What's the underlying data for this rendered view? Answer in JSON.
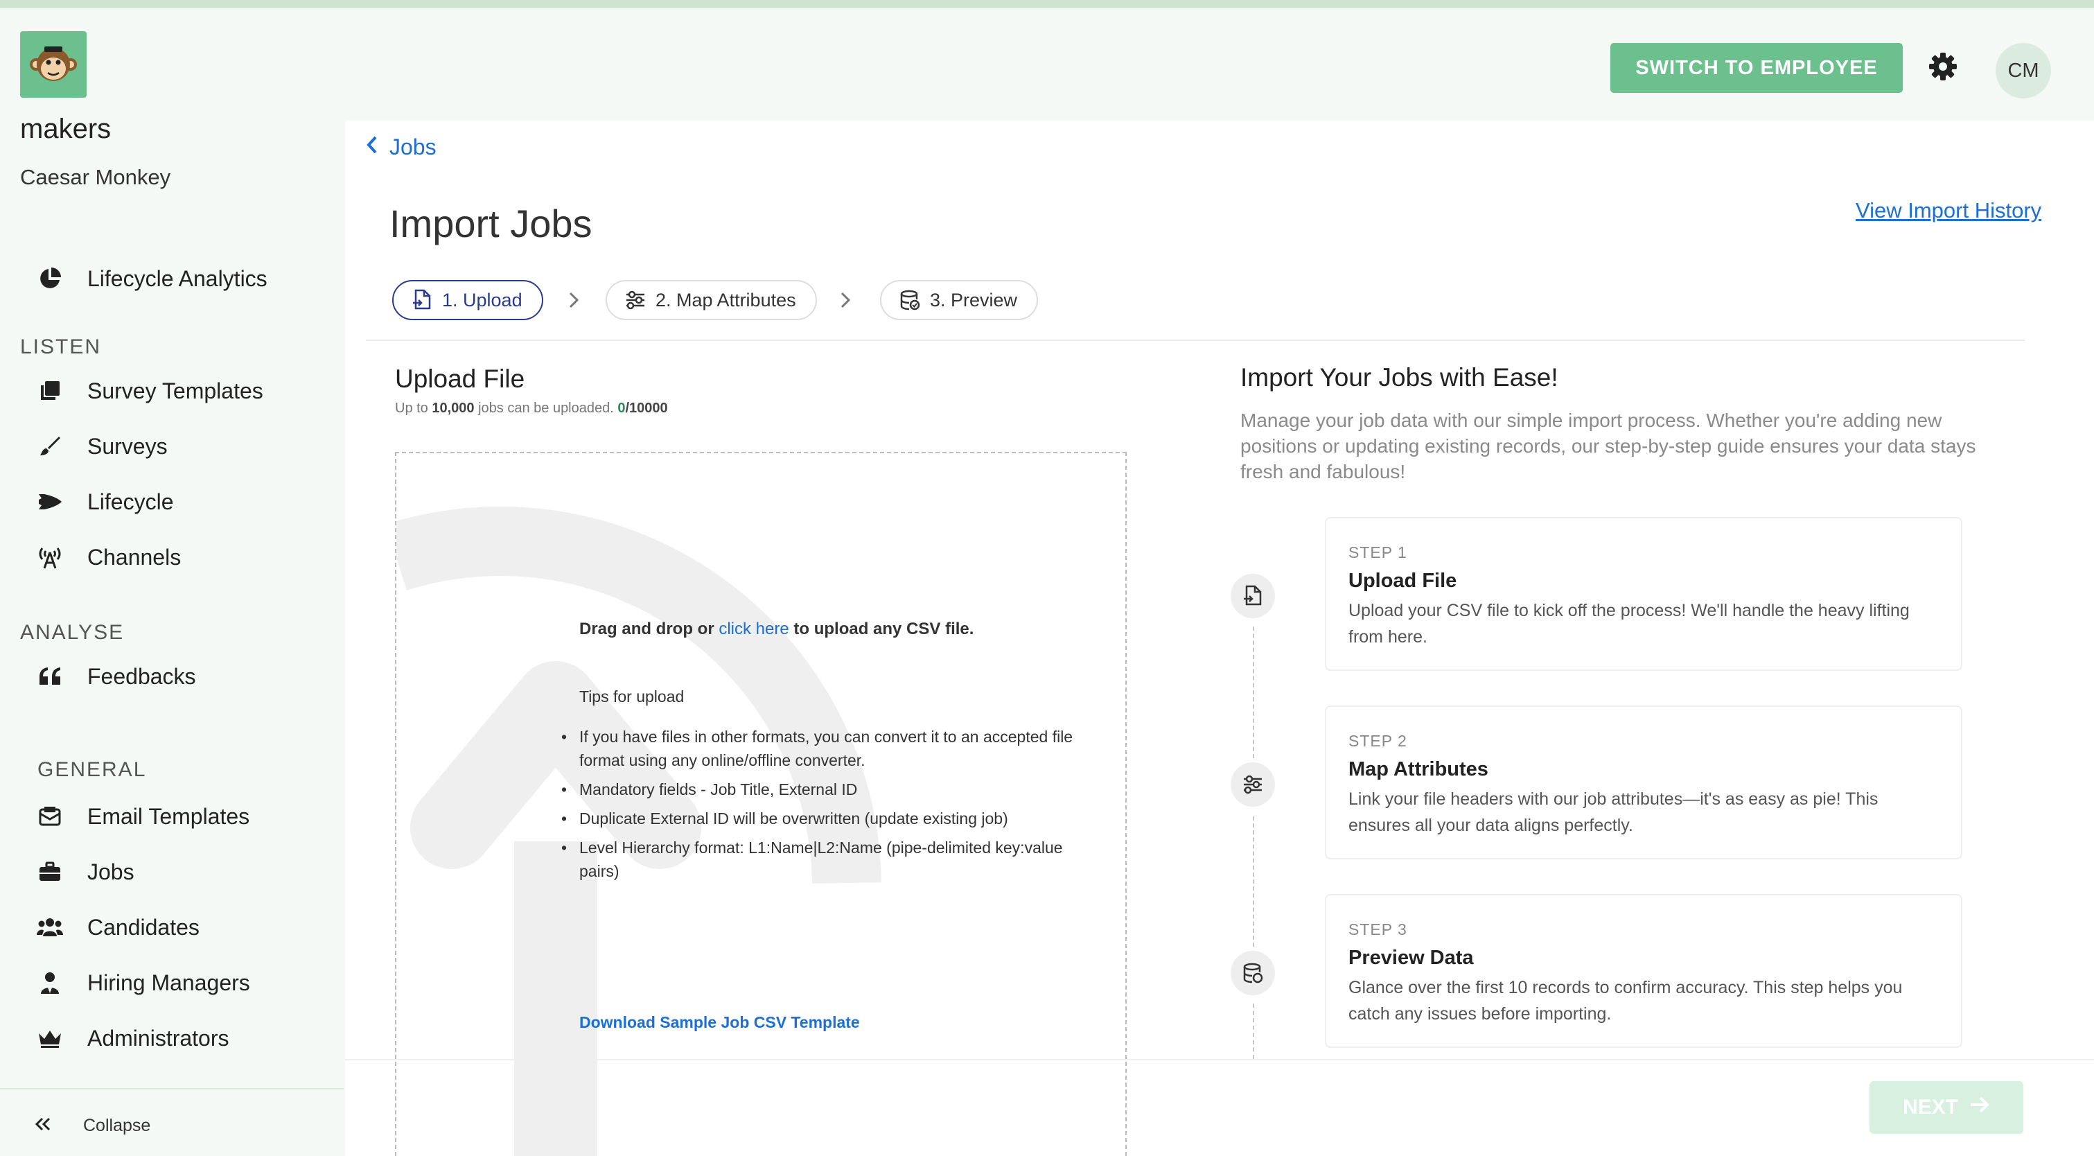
{
  "sidebar": {
    "org_name": "makers",
    "user_name": "Caesar Monkey",
    "items_top": [
      {
        "label": "Lifecycle Analytics",
        "icon": "pie-chart-icon"
      }
    ],
    "sections": [
      {
        "title": "LISTEN",
        "items": [
          {
            "label": "Survey Templates",
            "icon": "copy-icon"
          },
          {
            "label": "Surveys",
            "icon": "paint-brush-icon"
          },
          {
            "label": "Lifecycle",
            "icon": "space-shuttle-icon"
          },
          {
            "label": "Channels",
            "icon": "broadcast-tower-icon"
          }
        ]
      },
      {
        "title": "ANALYSE",
        "items": [
          {
            "label": "Feedbacks",
            "icon": "quote-icon"
          }
        ]
      },
      {
        "title": "GENERAL",
        "items": [
          {
            "label": "Email Templates",
            "icon": "envelope-icon"
          },
          {
            "label": "Jobs",
            "icon": "briefcase-icon"
          },
          {
            "label": "Candidates",
            "icon": "users-icon"
          },
          {
            "label": "Hiring Managers",
            "icon": "user-tie-icon"
          },
          {
            "label": "Administrators",
            "icon": "crown-icon"
          }
        ]
      }
    ],
    "collapse_label": "Collapse"
  },
  "header": {
    "switch_label": "SWITCH TO EMPLOYEE",
    "avatar_initials": "CM"
  },
  "main": {
    "back_label": "Jobs",
    "title": "Import Jobs",
    "history_link": "View Import History",
    "steps": [
      {
        "label": "1. Upload",
        "icon": "file-import-icon",
        "active": true
      },
      {
        "label": "2. Map Attributes",
        "icon": "sliders-icon",
        "active": false
      },
      {
        "label": "3. Preview",
        "icon": "database-icon",
        "active": false
      }
    ],
    "upload": {
      "title": "Upload File",
      "sub_prefix": "Up to ",
      "sub_limit": "10,000",
      "sub_mid": " jobs can be uploaded. ",
      "sub_count": "0",
      "sub_max": "/10000",
      "drag_prefix": "Drag and drop or ",
      "drag_link": "click here",
      "drag_suffix": " to upload any CSV file.",
      "tips_title": "Tips for upload",
      "tips": [
        "If you have files in other formats, you can convert it to an accepted file format using any online/offline converter.",
        "Mandatory fields - Job Title, External ID",
        "Duplicate External ID will be overwritten (update existing job)",
        "Level Hierarchy format: L1:Name|L2:Name (pipe-delimited key:value pairs)"
      ],
      "sample_link": "Download Sample Job CSV Template"
    },
    "guide": {
      "title": "Import Your Jobs with Ease!",
      "description": "Manage your job data with our simple import process. Whether you're adding new positions or updating existing records, our step-by-step guide ensures your data stays fresh and fabulous!",
      "steps": [
        {
          "label": "STEP 1",
          "title": "Upload File",
          "desc": "Upload your CSV file to kick off the process! We'll handle the heavy lifting from here.",
          "icon": "file-import-icon"
        },
        {
          "label": "STEP 2",
          "title": "Map Attributes",
          "desc": "Link your file headers with our job attributes—it's as easy as pie! This ensures all your data aligns perfectly.",
          "icon": "sliders-icon"
        },
        {
          "label": "STEP 3",
          "title": "Preview Data",
          "desc": "Glance over the first 10 records to confirm accuracy. This step helps you catch any issues before importing.",
          "icon": "database-icon"
        }
      ]
    },
    "next_label": "NEXT"
  },
  "colors": {
    "brand_green": "#6cc08e",
    "link_blue": "#1b6fd6",
    "active_step": "#2a3a8c",
    "next_disabled": "#d7f0e0"
  }
}
